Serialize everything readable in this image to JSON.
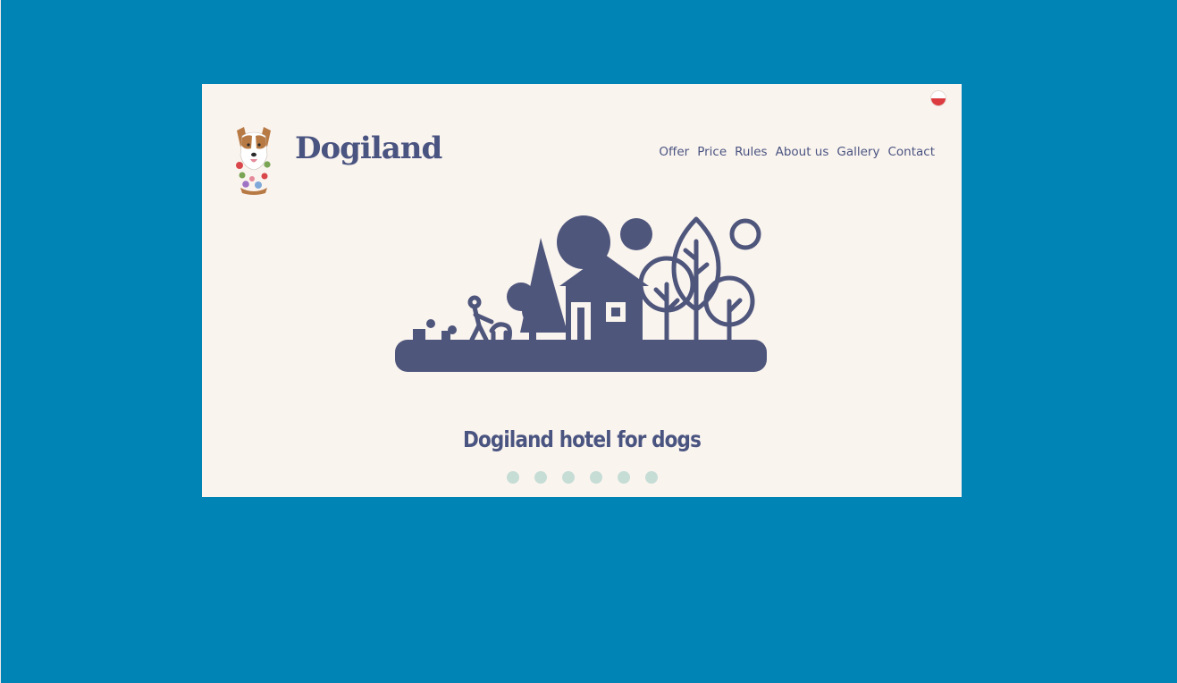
{
  "site": {
    "brand": "Dogiland",
    "language_flag": "polish-flag-icon"
  },
  "nav": {
    "items": [
      "Offer",
      "Price",
      "Rules",
      "About us",
      "Gallery",
      "Contact"
    ]
  },
  "hero": {
    "illustration": "dog-hotel-house-trees-illustration",
    "caption": "Dogiland hotel for dogs",
    "slide_count": 6
  },
  "colors": {
    "page_background": "#0083b5",
    "panel_background": "#faf4ef",
    "primary_text": "#4a5480",
    "slider_dot": "#c6ddd6"
  }
}
